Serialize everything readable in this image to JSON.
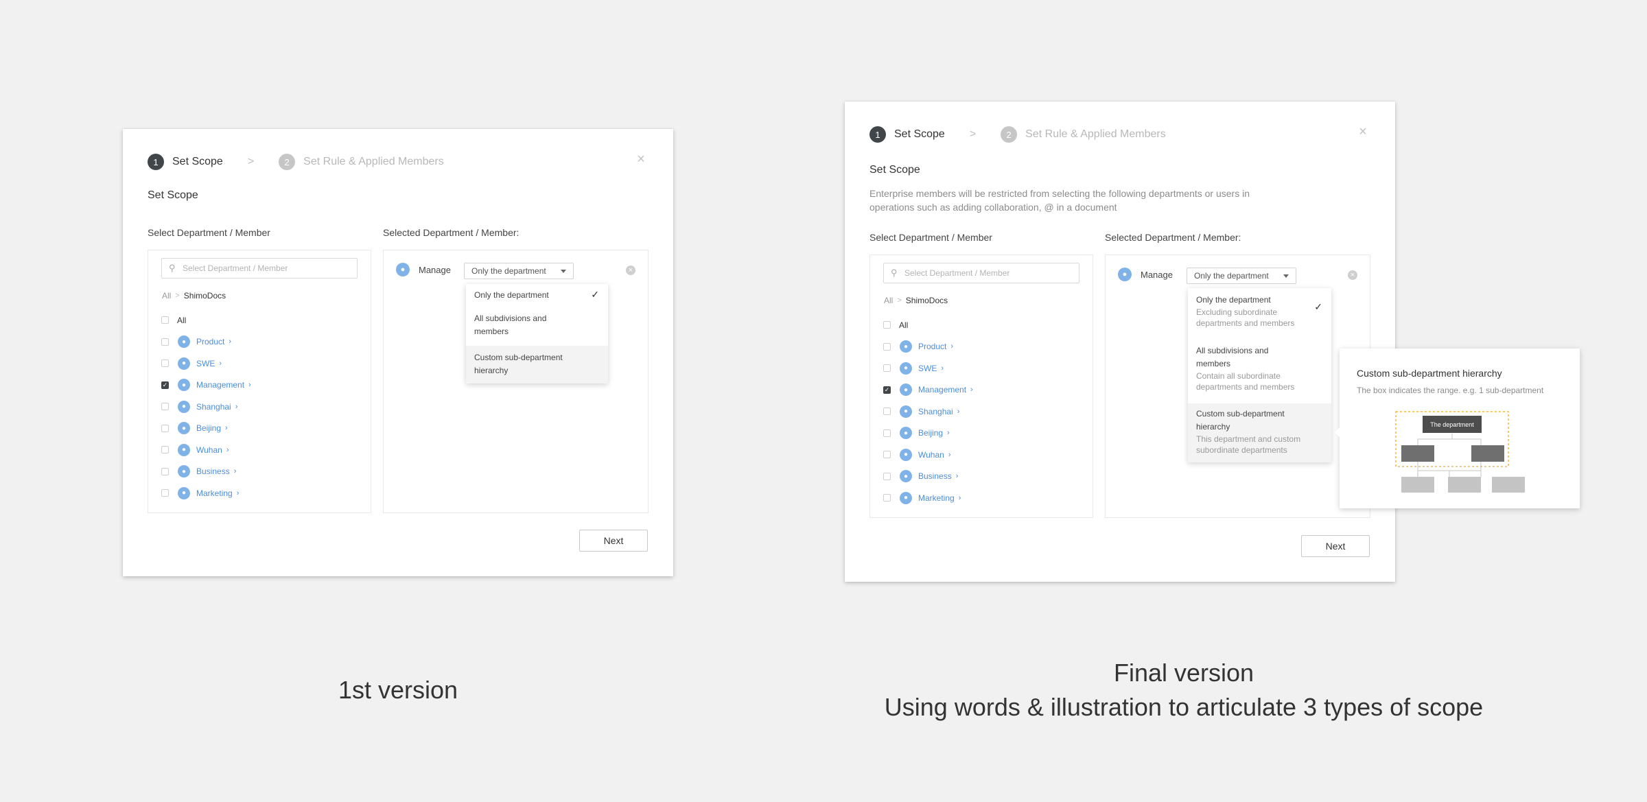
{
  "steps": [
    {
      "num": "1",
      "label": "Set Scope"
    },
    {
      "num": "2",
      "label": "Set Rule & Applied Members"
    }
  ],
  "step_separator": ">",
  "close_glyph": "×",
  "section_title": "Set Scope",
  "final_description": "Enterprise members will be restricted from selecting the following departments or users in operations such as adding collaboration, @ in a document",
  "left_panel": {
    "label": "Select Department / Member",
    "search_placeholder": "Select Department / Member",
    "breadcrumb": {
      "root": "All",
      "separator": ">",
      "current": "ShimoDocs"
    },
    "all_label": "All",
    "departments": [
      {
        "name": "Product",
        "checked": false
      },
      {
        "name": "SWE",
        "checked": false
      },
      {
        "name": "Management",
        "checked": true
      },
      {
        "name": "Shanghai",
        "checked": false
      },
      {
        "name": "Beijing",
        "checked": false
      },
      {
        "name": "Wuhan",
        "checked": false
      },
      {
        "name": "Business",
        "checked": false
      },
      {
        "name": "Marketing",
        "checked": false
      }
    ]
  },
  "right_panel": {
    "label": "Selected Department / Member:",
    "selected_name": "Manage",
    "dropdown_value": "Only the department"
  },
  "menu_v1": [
    {
      "label": "Only the department",
      "selected": true
    },
    {
      "label": "All subdivisions and members",
      "selected": false
    },
    {
      "label": "Custom sub-department hierarchy",
      "selected": false
    }
  ],
  "menu_final": [
    {
      "label": "Only the department",
      "desc": "Excluding subordinate departments and members",
      "selected": true
    },
    {
      "label": "All subdivisions and members",
      "desc": "Contain all subordinate departments and members",
      "selected": false
    },
    {
      "label": "Custom sub-department hierarchy",
      "desc": "This department and custom subordinate departments",
      "selected": false
    }
  ],
  "tooltip": {
    "title": "Custom sub-department hierarchy",
    "desc": "The box indicates the range. e.g. 1 sub-department",
    "root_label": "The department",
    "highlight_color": "#f5a623"
  },
  "next_label": "Next",
  "captions": {
    "v1": "1st version",
    "final_line1": "Final version",
    "final_line2": "Using words & illustration to articulate 3 types of scope"
  },
  "colors": {
    "accent_link": "#4a8ddd",
    "avatar": "#7fb3e8",
    "dark": "#41464b"
  }
}
